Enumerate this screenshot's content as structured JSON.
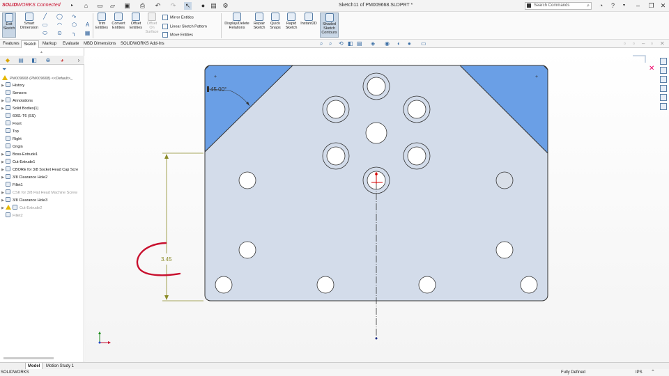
{
  "titlebar": {
    "brand_a": "SOLID",
    "brand_b": "WORKS Connected",
    "document_title": "Sketch11 of PM009668.SLDPRT *",
    "search_placeholder": "Search Commands"
  },
  "ribbon": {
    "exit_sketch": "Exit\nSketch",
    "smart_dimension": "Smart\nDimension",
    "trim_entities": "Trim\nEntities",
    "convert_entities": "Convert\nEntities",
    "offset_entities": "Offset\nEntities",
    "offset_on_surface": "Offset\nOn\nSurface",
    "mirror_entities": "Mirror Entities",
    "linear_sketch_pattern": "Linear Sketch Pattern",
    "move_entities": "Move Entities",
    "display_delete_relations": "Display/Delete\nRelations",
    "repair_sketch": "Repair\nSketch",
    "quick_snaps": "Quick\nSnaps",
    "rapid_sketch": "Rapid\nSketch",
    "instant2d": "Instant2D",
    "shaded_sketch_contours": "Shaded\nSketch\nContours"
  },
  "command_tabs": [
    "Features",
    "Sketch",
    "Markup",
    "Evaluate",
    "MBD Dimensions",
    "SOLIDWORKS Add-Ins"
  ],
  "feature_tree": {
    "root": "PM009668 (PM009668) <<Default>_",
    "items": [
      {
        "label": "History",
        "arrow": true,
        "grey": false,
        "warn": false
      },
      {
        "label": "Sensors",
        "arrow": false,
        "grey": false,
        "warn": false
      },
      {
        "label": "Annotations",
        "arrow": true,
        "grey": false,
        "warn": false
      },
      {
        "label": "Solid Bodies(1)",
        "arrow": true,
        "grey": false,
        "warn": false
      },
      {
        "label": "6061-T6 (SS)",
        "arrow": false,
        "grey": false,
        "warn": false
      },
      {
        "label": "Front",
        "arrow": false,
        "grey": false,
        "warn": false
      },
      {
        "label": "Top",
        "arrow": false,
        "grey": false,
        "warn": false
      },
      {
        "label": "Right",
        "arrow": false,
        "grey": false,
        "warn": false
      },
      {
        "label": "Origin",
        "arrow": false,
        "grey": false,
        "warn": false
      },
      {
        "label": "Boss-Extrude1",
        "arrow": true,
        "grey": false,
        "warn": false
      },
      {
        "label": "Cut-Extrude1",
        "arrow": true,
        "grey": false,
        "warn": false
      },
      {
        "label": "CBORE for 3/8 Socket Head Cap Scre",
        "arrow": true,
        "grey": false,
        "warn": false
      },
      {
        "label": "3/8 Clearance Hole2",
        "arrow": true,
        "grey": false,
        "warn": false
      },
      {
        "label": "Fillet1",
        "arrow": false,
        "grey": false,
        "warn": false
      },
      {
        "label": "CSK for 3/8 Flat Head Machine Screw",
        "arrow": true,
        "grey": true,
        "warn": false
      },
      {
        "label": "3/8 Clearance Hole3",
        "arrow": true,
        "grey": false,
        "warn": false
      },
      {
        "label": "Cut-Extrude2",
        "arrow": true,
        "grey": true,
        "warn": true
      },
      {
        "label": "Fillet2",
        "arrow": false,
        "grey": true,
        "warn": false
      }
    ]
  },
  "sketch": {
    "angle_dimension": "45.00°",
    "linear_dimension": "3.45",
    "colors": {
      "plate_fill": "#d3dcea",
      "region_fill": "#6a9fe6",
      "dimension": "#8b8b28",
      "annotation_red": "#c8102e",
      "point_red": "#d20000"
    }
  },
  "bottom_tabs": [
    "Model",
    "Motion Study 1"
  ],
  "status": {
    "app": "SOLIDWORKS",
    "sketch_state": "Fully Defined",
    "units": "IPS"
  }
}
